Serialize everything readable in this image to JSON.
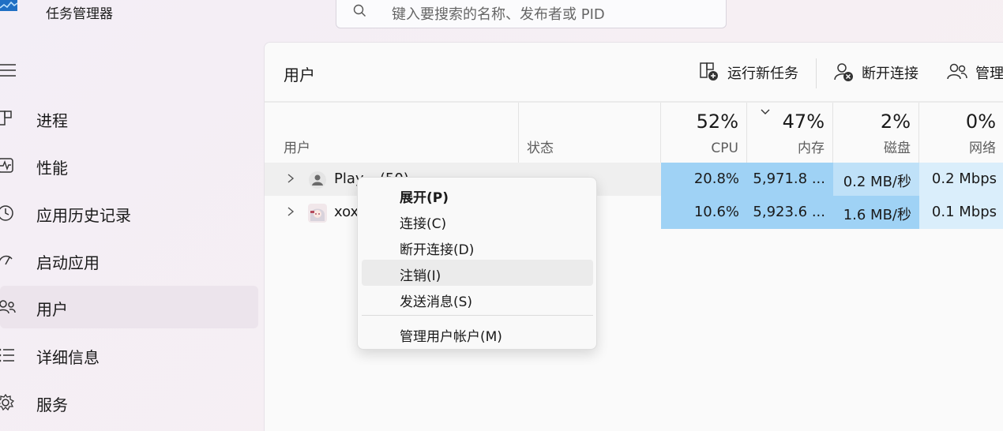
{
  "app": {
    "title": "任务管理器"
  },
  "search": {
    "placeholder": "键入要搜索的名称、发布者或 PID"
  },
  "sidebar": {
    "items": [
      {
        "label": "进程",
        "icon": "processes-icon"
      },
      {
        "label": "性能",
        "icon": "performance-icon"
      },
      {
        "label": "应用历史记录",
        "icon": "history-icon"
      },
      {
        "label": "启动应用",
        "icon": "startup-icon"
      },
      {
        "label": "用户",
        "icon": "users-icon",
        "active": true
      },
      {
        "label": "详细信息",
        "icon": "details-icon"
      },
      {
        "label": "服务",
        "icon": "services-icon"
      }
    ]
  },
  "main": {
    "title": "用户",
    "toolbar": {
      "run_new_task": "运行新任务",
      "disconnect": "断开连接",
      "manage": "管理"
    },
    "columns": {
      "user": "用户",
      "status": "状态",
      "cpu": {
        "pct": "52%",
        "label": "CPU"
      },
      "memory": {
        "pct": "47%",
        "label": "内存"
      },
      "disk": {
        "pct": "2%",
        "label": "磁盘"
      },
      "network": {
        "pct": "0%",
        "label": "网络"
      }
    },
    "rows": [
      {
        "name": "Play... (50)",
        "cpu": "20.8%",
        "memory": "5,971.8 ...",
        "disk": "0.2 MB/秒",
        "network": "0.2 Mbps"
      },
      {
        "name": "xox",
        "cpu": "10.6%",
        "memory": "5,923.6 ...",
        "disk": "1.6 MB/秒",
        "network": "0.1 Mbps"
      }
    ]
  },
  "context_menu": {
    "expand": "展开(P)",
    "connect": "连接(C)",
    "disconnect": "断开连接(D)",
    "sign_out": "注销(I)",
    "send_message": "发送消息(S)",
    "manage_accounts": "管理用户帐户(M)"
  },
  "colors": {
    "heat_dark": "#9fd2f5",
    "heat_medium": "#bfe1f8",
    "heat_light": "#daeefb",
    "active_nav": "#ece4ec"
  }
}
